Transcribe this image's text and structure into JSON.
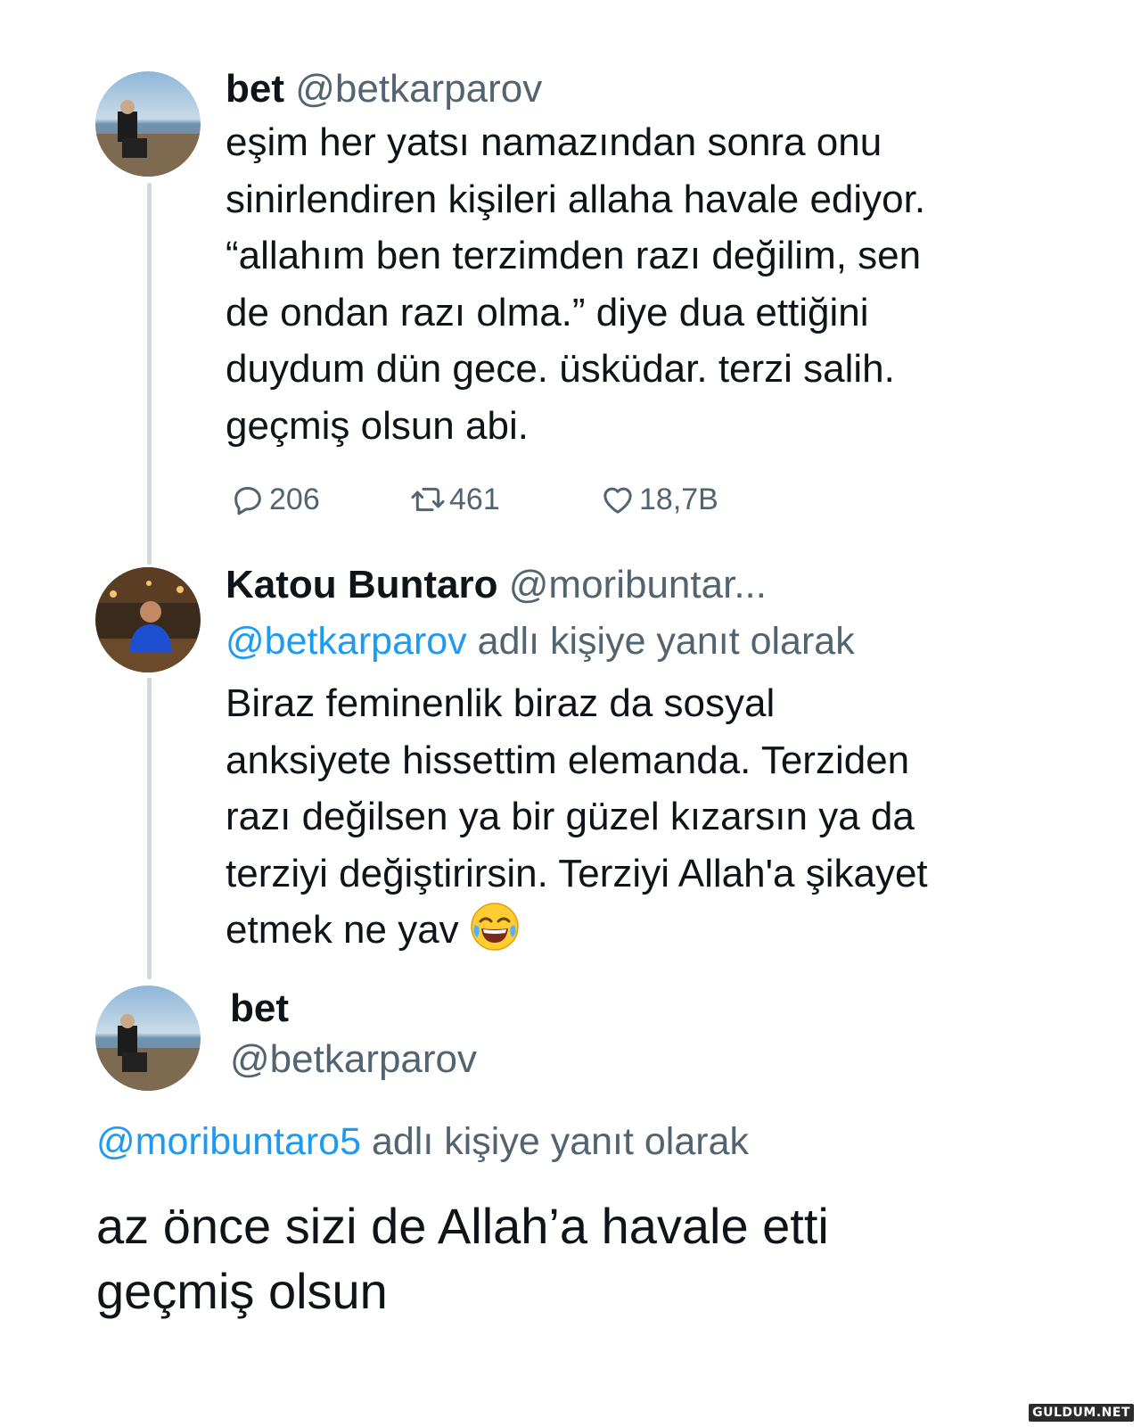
{
  "tweet1": {
    "name": "bet",
    "handle": "@betkarparov",
    "lines": [
      "eşim her yatsı namazından sonra onu",
      "sinirlendiren kişileri allaha havale ediyor.",
      "“allahım ben terzimden razı değilim, sen",
      "de ondan razı olma.” diye dua ettiğini",
      "duydum dün gece. üsküdar. terzi salih.",
      "geçmiş olsun abi."
    ],
    "replies": "206",
    "retweets": "461",
    "likes": "18,7B",
    "icons": [
      "reply-icon",
      "retweet-icon",
      "like-icon"
    ]
  },
  "tweet2": {
    "name": "Katou Buntaro",
    "handle": "@moribuntar...",
    "reply_mention": "@betkarparov",
    "reply_suffix": " adlı kişiye yanıt olarak",
    "lines": [
      "Biraz feminenlik biraz da sosyal",
      "anksiyete hissettim elemanda. Terziden",
      "razı değilsen ya bir güzel kızarsın ya da",
      "terziyi değiştirirsin. Terziyi Allah'a şikayet",
      "etmek ne yav"
    ],
    "emoji": "face-with-tears-of-joy-emoji"
  },
  "tweet3": {
    "name": "bet",
    "handle": "@betkarparov",
    "reply_mention": "@moribuntaro5",
    "reply_suffix": " adlı kişiye yanıt olarak",
    "lines": [
      "az önce sizi de Allah’a havale etti",
      "geçmiş olsun"
    ]
  },
  "watermark": "GULDUM.NET",
  "colors": {
    "text": "#0f1419",
    "secondary": "#536471",
    "link": "#1d9bf0",
    "thread_line": "#cfd9de"
  }
}
